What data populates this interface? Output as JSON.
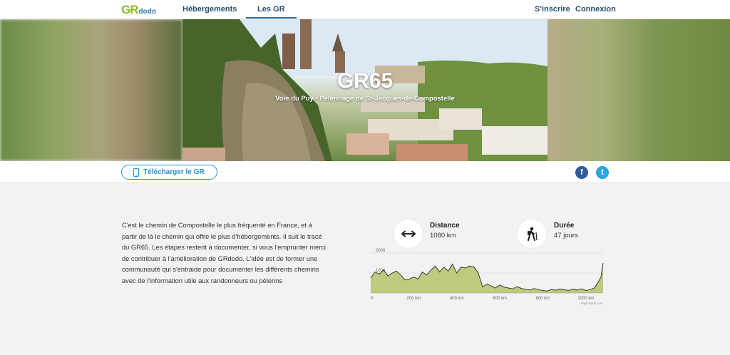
{
  "nav": {
    "logo_gr": "GR",
    "logo_dodo": "dodo",
    "links": [
      "Hébergements",
      "Les GR"
    ],
    "active_link": "Les GR",
    "signup": "S'inscrire",
    "login": "Connexion"
  },
  "hero": {
    "title": "GR65",
    "subtitle": "Voie du Puy - Pèlerinage de St-Jacques-de-Compostelle"
  },
  "actions": {
    "download_label": "Télécharger le GR",
    "facebook_glyph": "f",
    "twitter_glyph": "t"
  },
  "description": "C'est le chemin de Compostelle le plus fréquenté en France, et à partir de là le chemin qui offre le plus d'hébergements. Il suit le tracé du GR65. Les étapes restent à documenter, si vous l'emprunter merci de contribuer à l'amélioration de GRdodo. L'idée est de former une communauté qui s'entraide pour documenter les différents chemins avec de l'information utile aux randonneurs ou pèlerins",
  "stats": {
    "distance_label": "Distance",
    "distance_value": "1080 km",
    "duration_label": "Durée",
    "duration_value": "47 jours"
  },
  "chart_data": {
    "type": "area",
    "title": "",
    "xlabel": "",
    "ylabel": "",
    "x_unit": "km",
    "xlim": [
      0,
      1080
    ],
    "ylim": [
      0,
      2000
    ],
    "yticks": [
      1000,
      2000
    ],
    "xticks": [
      0,
      200,
      400,
      600,
      800,
      1000
    ],
    "xtick_labels": [
      "0",
      "200 km",
      "400 km",
      "600 km",
      "800 km",
      "1000 km"
    ],
    "credit": "Highcharts.com",
    "color": "#b5c46a",
    "series": [
      {
        "x": [
          0,
          20,
          40,
          60,
          80,
          100,
          120,
          140,
          160,
          180,
          200,
          220,
          240,
          260,
          280,
          300,
          320,
          340,
          360,
          380,
          400,
          420,
          440,
          460,
          480,
          500,
          520,
          540,
          560,
          580,
          600,
          620,
          640,
          660,
          680,
          700,
          720,
          740,
          760,
          780,
          800,
          820,
          840,
          860,
          880,
          900,
          920,
          940,
          960,
          980,
          1000,
          1020,
          1040,
          1060,
          1070,
          1080
        ],
        "y": [
          750,
          1050,
          950,
          1150,
          850,
          1000,
          1100,
          900,
          650,
          700,
          800,
          700,
          1050,
          900,
          1150,
          1350,
          1050,
          1300,
          1100,
          1450,
          1000,
          1300,
          1250,
          1350,
          1300,
          1000,
          300,
          450,
          350,
          250,
          400,
          300,
          250,
          200,
          320,
          230,
          180,
          150,
          220,
          170,
          120,
          100,
          180,
          140,
          200,
          160,
          130,
          190,
          150,
          210,
          120,
          170,
          250,
          600,
          800,
          1500
        ]
      }
    ]
  }
}
